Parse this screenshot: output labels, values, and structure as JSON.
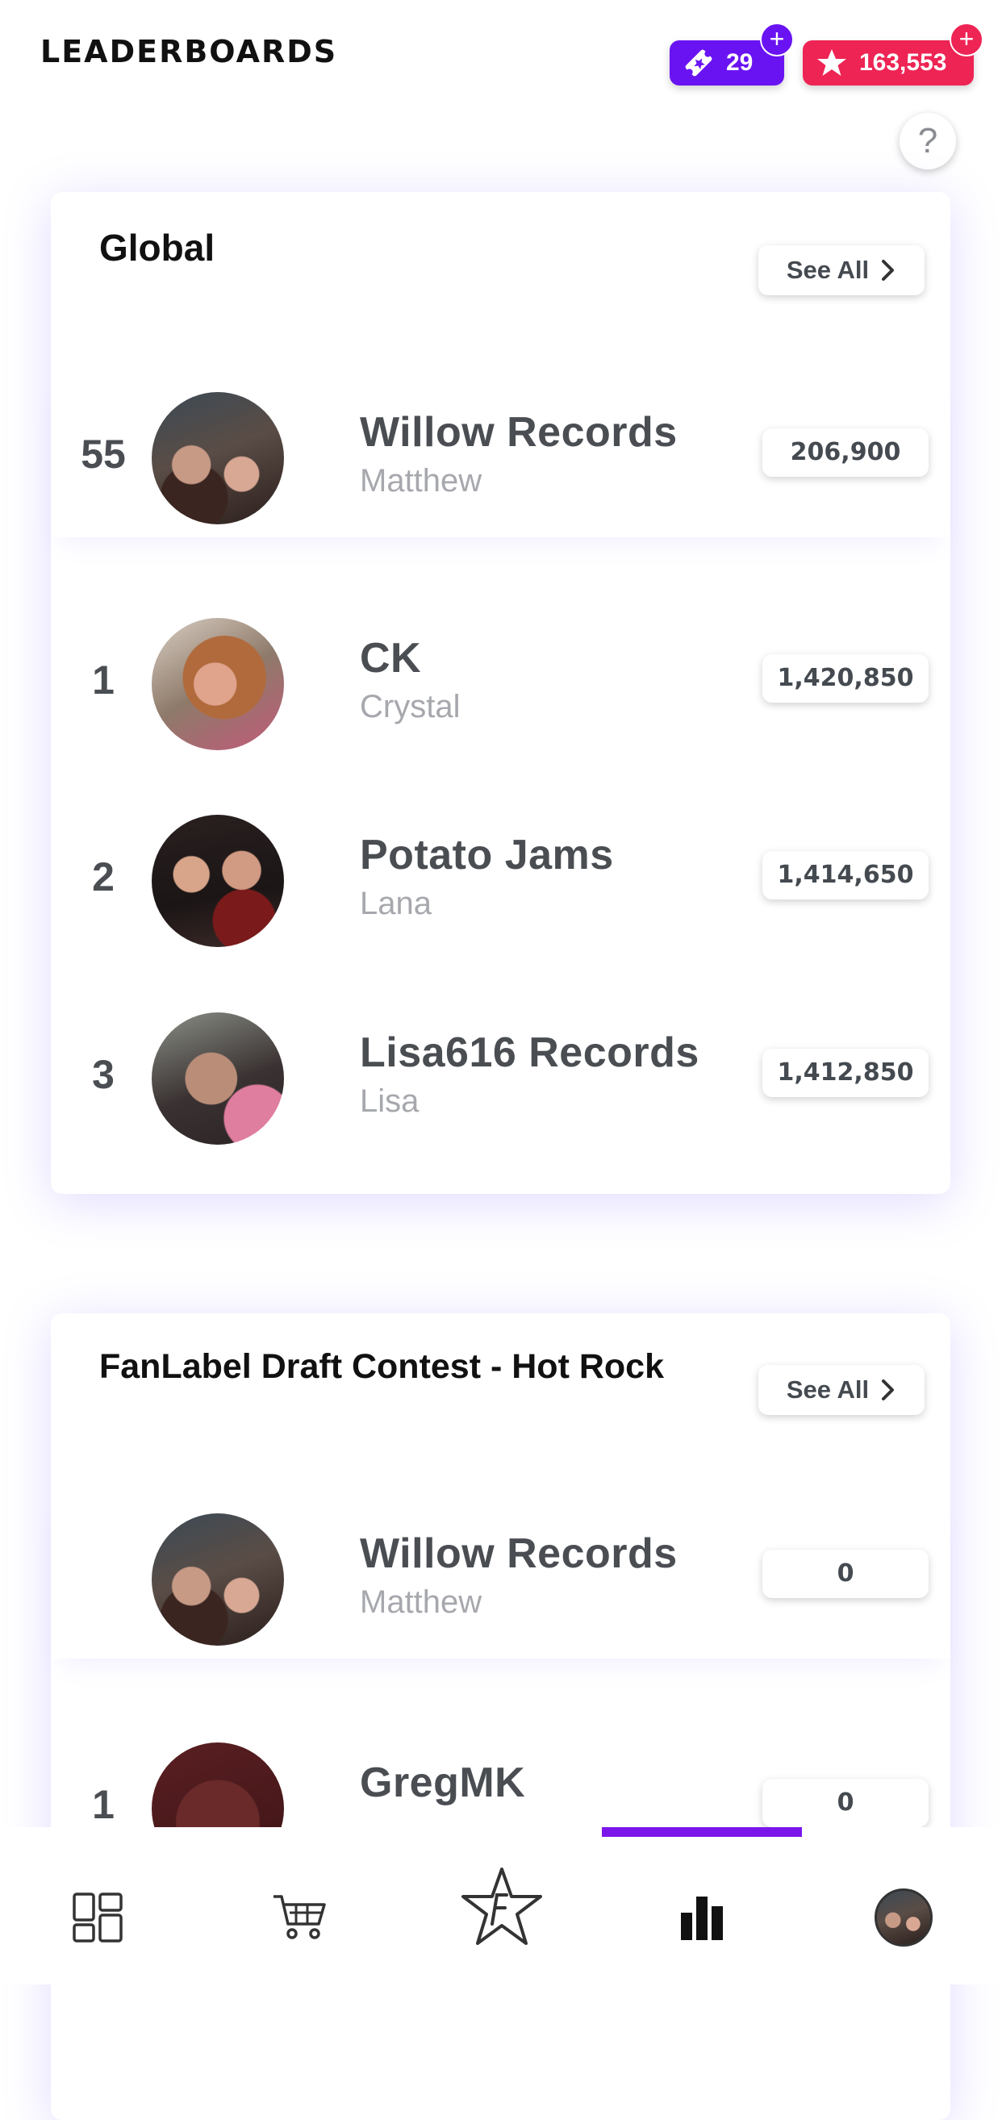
{
  "header": {
    "title": "LEADERBOARDS",
    "tickets": "29",
    "points": "163,553",
    "plus": "+",
    "help": "?"
  },
  "colors": {
    "tickets_bg": "#6a13f2",
    "points_bg": "#ee2454",
    "nav_accent": "#7b16ea"
  },
  "global": {
    "title": "Global",
    "see_all": "See All",
    "me": {
      "rank": "55",
      "label": "Willow Records",
      "user": "Matthew",
      "score": "206,900"
    },
    "rows": [
      {
        "rank": "1",
        "label": "CK",
        "user": "Crystal",
        "score": "1,420,850"
      },
      {
        "rank": "2",
        "label": "Potato Jams",
        "user": "Lana",
        "score": "1,414,650"
      },
      {
        "rank": "3",
        "label": "Lisa616 Records",
        "user": "Lisa",
        "score": "1,412,850"
      }
    ]
  },
  "contest": {
    "title": "FanLabel Draft Contest - Hot Rock",
    "see_all": "See All",
    "me": {
      "rank": "",
      "label": "Willow Records",
      "user": "Matthew",
      "score": "0"
    },
    "rows": [
      {
        "rank": "1",
        "label": "GregMK",
        "user": "",
        "score": "0"
      }
    ]
  },
  "nav": {
    "items": [
      "dashboard-icon",
      "cart-icon",
      "fanlabel-star-icon",
      "leaderboard-icon",
      "profile-avatar"
    ],
    "active": "leaderboard-icon"
  }
}
